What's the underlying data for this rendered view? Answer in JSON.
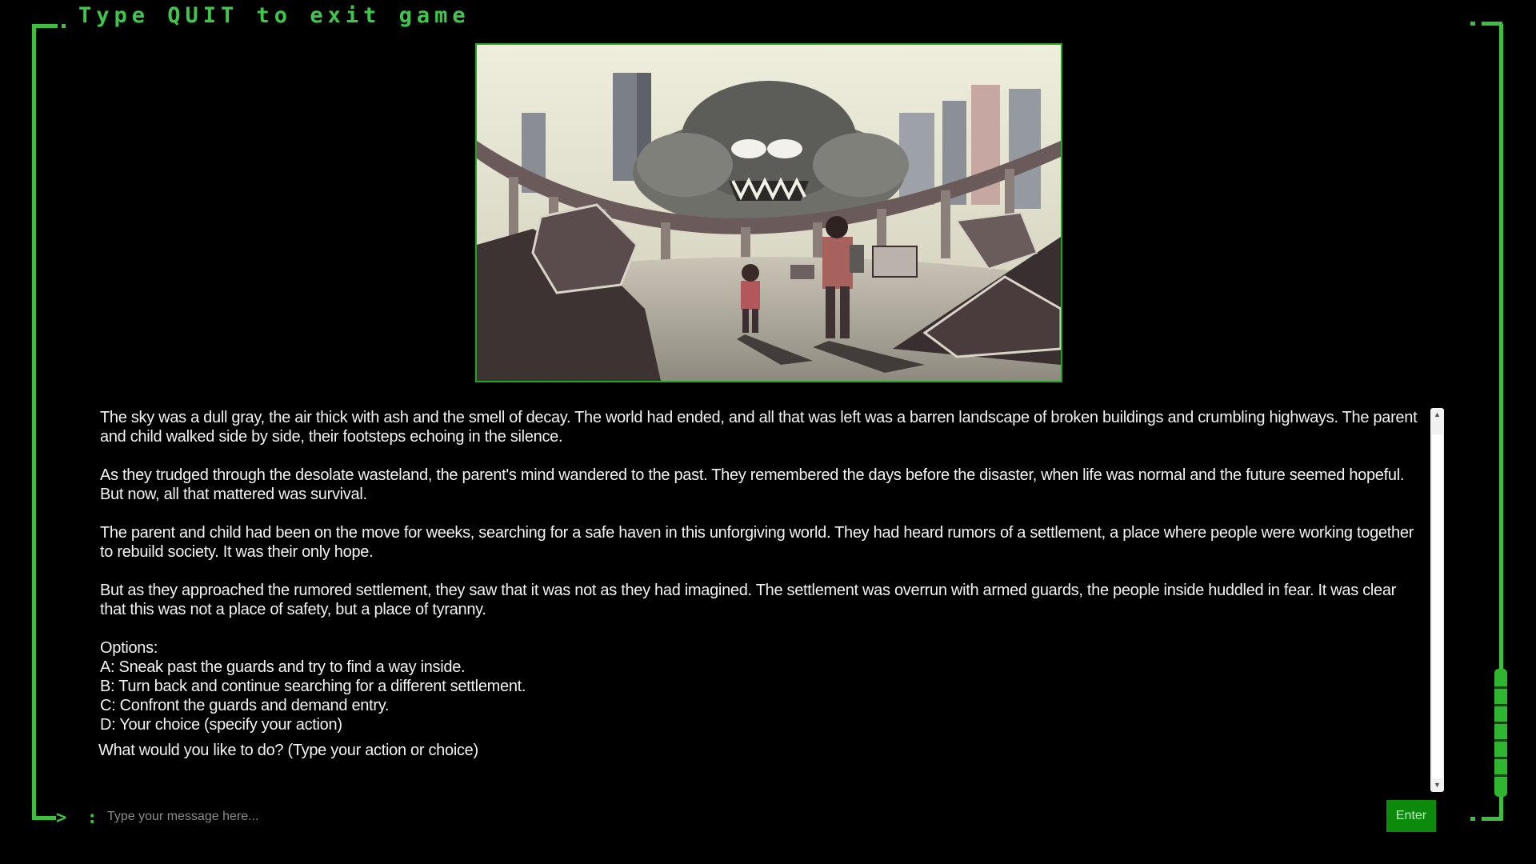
{
  "header": {
    "title": "Type QUIT to exit game"
  },
  "prompt": {
    "symbol": ">",
    "separator": ":"
  },
  "scene_image": {
    "description_icon": "pixel-art-apocalypse-scene"
  },
  "story": {
    "paragraphs": [
      "The sky was a dull gray, the air thick with ash and the smell of decay. The world had ended, and all that was left was a barren landscape of broken buildings and crumbling highways. The parent and child walked side by side, their footsteps echoing in the silence.",
      "As they trudged through the desolate wasteland, the parent's mind wandered to the past. They remembered the days before the disaster, when life was normal and the future seemed hopeful. But now, all that mattered was survival.",
      "The parent and child had been on the move for weeks, searching for a safe haven in this unforgiving world. They had heard rumors of a settlement, a place where people were working together to rebuild society. It was their only hope.",
      "But as they approached the rumored settlement, they saw that it was not as they had imagined. The settlement was overrun with armed guards, the people inside huddled in fear. It was clear that this was not a place of safety, but a place of tyranny."
    ],
    "options_label": "Options:",
    "options": [
      "A: Sneak past the guards and try to find a way inside.",
      "B: Turn back and continue searching for a different settlement.",
      "C: Confront the guards and demand entry.",
      "D: Your choice (specify your action)"
    ],
    "question": "What would you like to do? (Type your action or choice)"
  },
  "input": {
    "placeholder": "Type your message here...",
    "value": ""
  },
  "enter_button": {
    "label": "Enter"
  },
  "colors": {
    "background": "#000000",
    "accent_green": "#3fbf3f",
    "button_green": "#0c8a0c",
    "text": "#f2f2f2"
  }
}
